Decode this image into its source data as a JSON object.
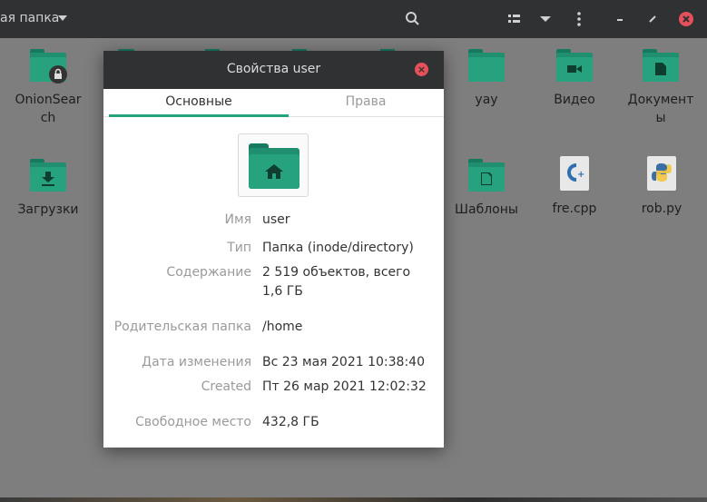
{
  "header": {
    "title": "ая папка"
  },
  "files": [
    {
      "label": "OnionSearch",
      "type": "folder-locked"
    },
    {
      "label": "yay",
      "type": "folder"
    },
    {
      "label": "Видео",
      "type": "folder-video"
    },
    {
      "label": "Документы",
      "type": "folder-documents"
    },
    {
      "label": "Загрузки",
      "type": "folder-downloads"
    },
    {
      "label": "Шаблоны",
      "type": "folder-templates"
    },
    {
      "label": "fre.cpp",
      "type": "cpp-file"
    },
    {
      "label": "rob.py",
      "type": "python-file"
    }
  ],
  "dialog": {
    "title": "Свойства user",
    "tabs": {
      "basic": "Основные",
      "permissions": "Права"
    },
    "props": {
      "name_label": "Имя",
      "name_value": "user",
      "type_label": "Тип",
      "type_value": "Папка (inode/directory)",
      "contents_label": "Содержание",
      "contents_value": "2 519 объектов, всего 1,6 ГБ",
      "parent_label": "Родительская папка",
      "parent_value": "/home",
      "modified_label": "Дата изменения",
      "modified_value": "Вс 23 мая 2021 10:38:40",
      "created_label": "Created",
      "created_value": "Пт 26 мар 2021 12:02:32",
      "free_label": "Свободное место",
      "free_value": "432,8 ГБ"
    }
  },
  "colors": {
    "accent": "#26a27f",
    "header": "#2f3133",
    "close": "#e5505a"
  }
}
